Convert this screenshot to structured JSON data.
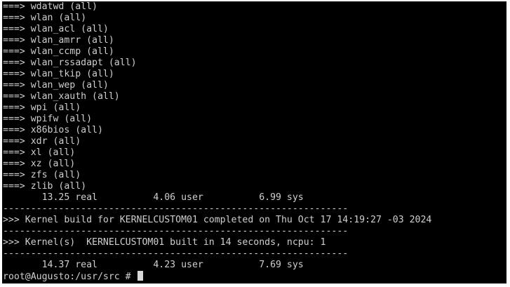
{
  "terminal": {
    "lines": [
      "===> wdatwd (all)",
      "===> wlan (all)",
      "===> wlan_acl (all)",
      "===> wlan_amrr (all)",
      "===> wlan_ccmp (all)",
      "===> wlan_rssadapt (all)",
      "===> wlan_tkip (all)",
      "===> wlan_wep (all)",
      "===> wlan_xauth (all)",
      "===> wpi (all)",
      "===> wpifw (all)",
      "===> x86bios (all)",
      "===> xdr (all)",
      "===> xl (all)",
      "===> xz (all)",
      "===> zfs (all)",
      "===> zlib (all)",
      "       13.25 real          4.06 user          6.99 sys",
      "--------------------------------------------------------------",
      ">>> Kernel build for KERNELCUSTOM01 completed on Thu Oct 17 14:19:27 -03 2024",
      "--------------------------------------------------------------",
      ">>> Kernel(s)  KERNELCUSTOM01 built in 14 seconds, ncpu: 1",
      "--------------------------------------------------------------",
      "       14.37 real          4.23 user          7.69 sys"
    ],
    "prompt": "root@Augusto:/usr/src # ",
    "colors": {
      "background": "#000000",
      "foreground": "#cfcfcf",
      "cursor": "#d8d8d8"
    }
  }
}
